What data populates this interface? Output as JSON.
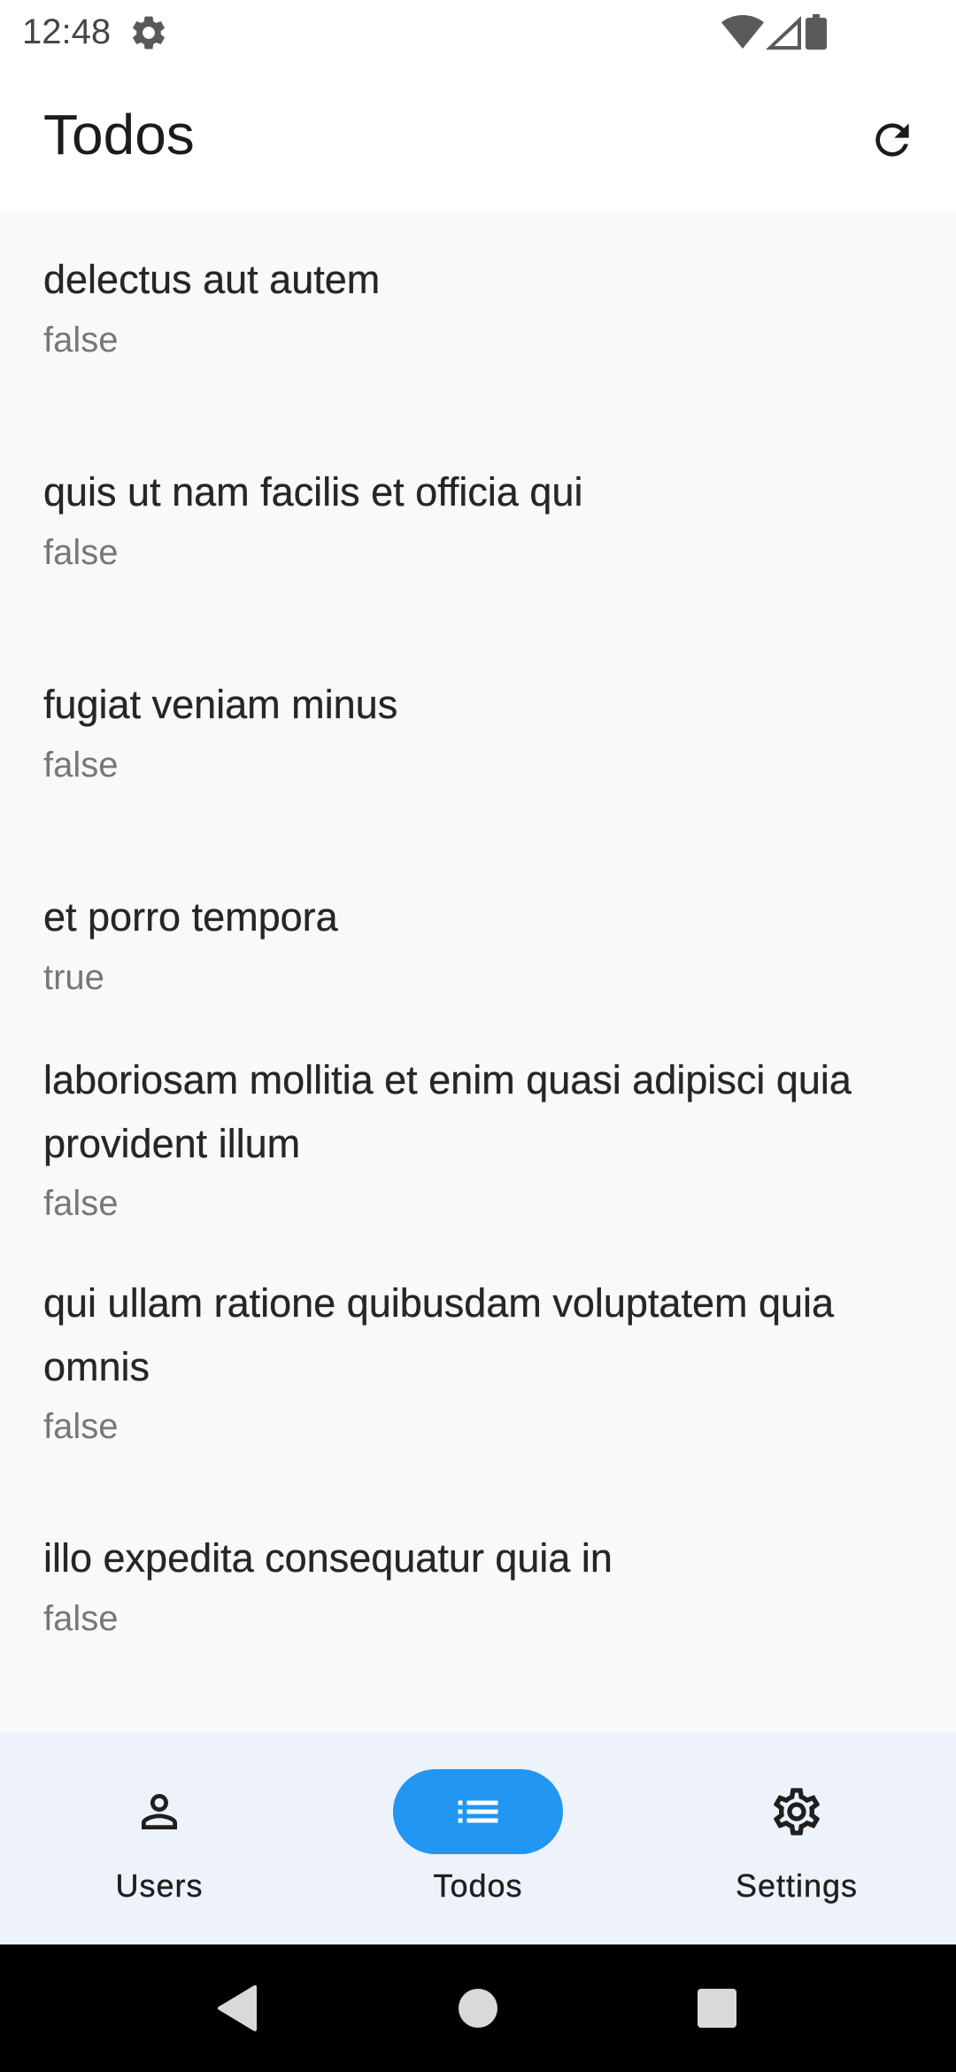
{
  "status_bar": {
    "time": "12:48",
    "icons": [
      "settings-gear-icon",
      "wifi-icon",
      "cell-signal-icon",
      "battery-icon"
    ]
  },
  "app_bar": {
    "title": "Todos",
    "refresh_icon": "refresh-icon"
  },
  "todos": [
    {
      "title": "delectus aut autem",
      "completed": "false"
    },
    {
      "title": "quis ut nam facilis et officia qui",
      "completed": "false"
    },
    {
      "title": "fugiat veniam minus",
      "completed": "false"
    },
    {
      "title": "et porro tempora",
      "completed": "true"
    },
    {
      "title": "laboriosam mollitia et enim quasi adipisci quia provident illum",
      "completed": "false"
    },
    {
      "title": "qui ullam ratione quibusdam voluptatem quia omnis",
      "completed": "false"
    },
    {
      "title": "illo expedita consequatur quia in",
      "completed": "false"
    }
  ],
  "bottom_nav": {
    "items": [
      {
        "label": "Users",
        "icon": "person-icon",
        "active": false
      },
      {
        "label": "Todos",
        "icon": "list-icon",
        "active": true
      },
      {
        "label": "Settings",
        "icon": "gear-icon",
        "active": false
      }
    ],
    "active_color": "#2196f3"
  },
  "system_nav": {
    "icons": [
      "back-icon",
      "home-icon",
      "recents-icon"
    ]
  }
}
